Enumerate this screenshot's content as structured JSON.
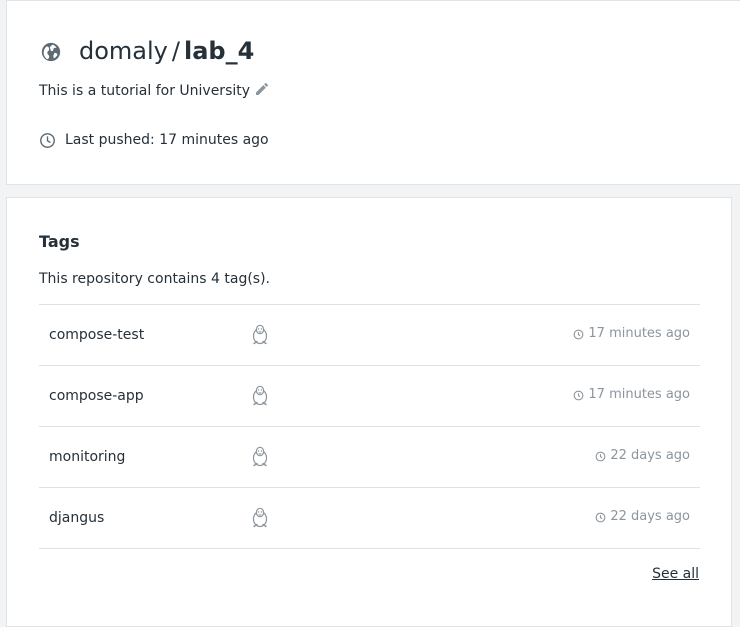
{
  "repo": {
    "owner": "domaly",
    "separator": "/",
    "name": "lab_4",
    "description": "This is a tutorial for University",
    "last_pushed": "Last pushed: 17 minutes ago"
  },
  "tags": {
    "heading": "Tags",
    "count_text": "This repository contains 4 tag(s).",
    "rows": [
      {
        "name": "compose-test",
        "os_icon": "linux-tux-icon",
        "time": "17 minutes ago"
      },
      {
        "name": "compose-app",
        "os_icon": "linux-tux-icon",
        "time": "17 minutes ago"
      },
      {
        "name": "monitoring",
        "os_icon": "linux-tux-icon",
        "time": "22 days ago"
      },
      {
        "name": "djangus",
        "os_icon": "linux-tux-icon",
        "time": "22 days ago"
      }
    ],
    "see_all": "See all"
  },
  "colors": {
    "text": "#253039",
    "muted": "#8b959e",
    "border": "#dfe2e5",
    "background": "#f2f3f4"
  }
}
